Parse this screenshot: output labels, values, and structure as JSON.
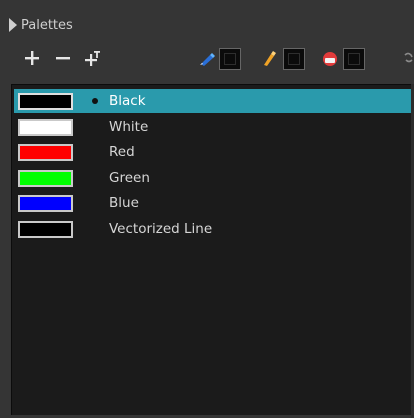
{
  "panel": {
    "title": "Palettes"
  },
  "toolbar": {
    "add_label": "+",
    "remove_label": "−"
  },
  "colors": {
    "selection": "#2a9aac",
    "list_background": "#1b1b1b",
    "panel_background": "#353535"
  },
  "swatches": [
    {
      "name": "Black",
      "color": "#000000",
      "selected": true
    },
    {
      "name": "White",
      "color": "#ffffff",
      "selected": false
    },
    {
      "name": "Red",
      "color": "#ff0000",
      "selected": false
    },
    {
      "name": "Green",
      "color": "#00ff00",
      "selected": false
    },
    {
      "name": "Blue",
      "color": "#0000ff",
      "selected": false
    },
    {
      "name": "Vectorized Line",
      "color": "#000000",
      "selected": false
    }
  ]
}
